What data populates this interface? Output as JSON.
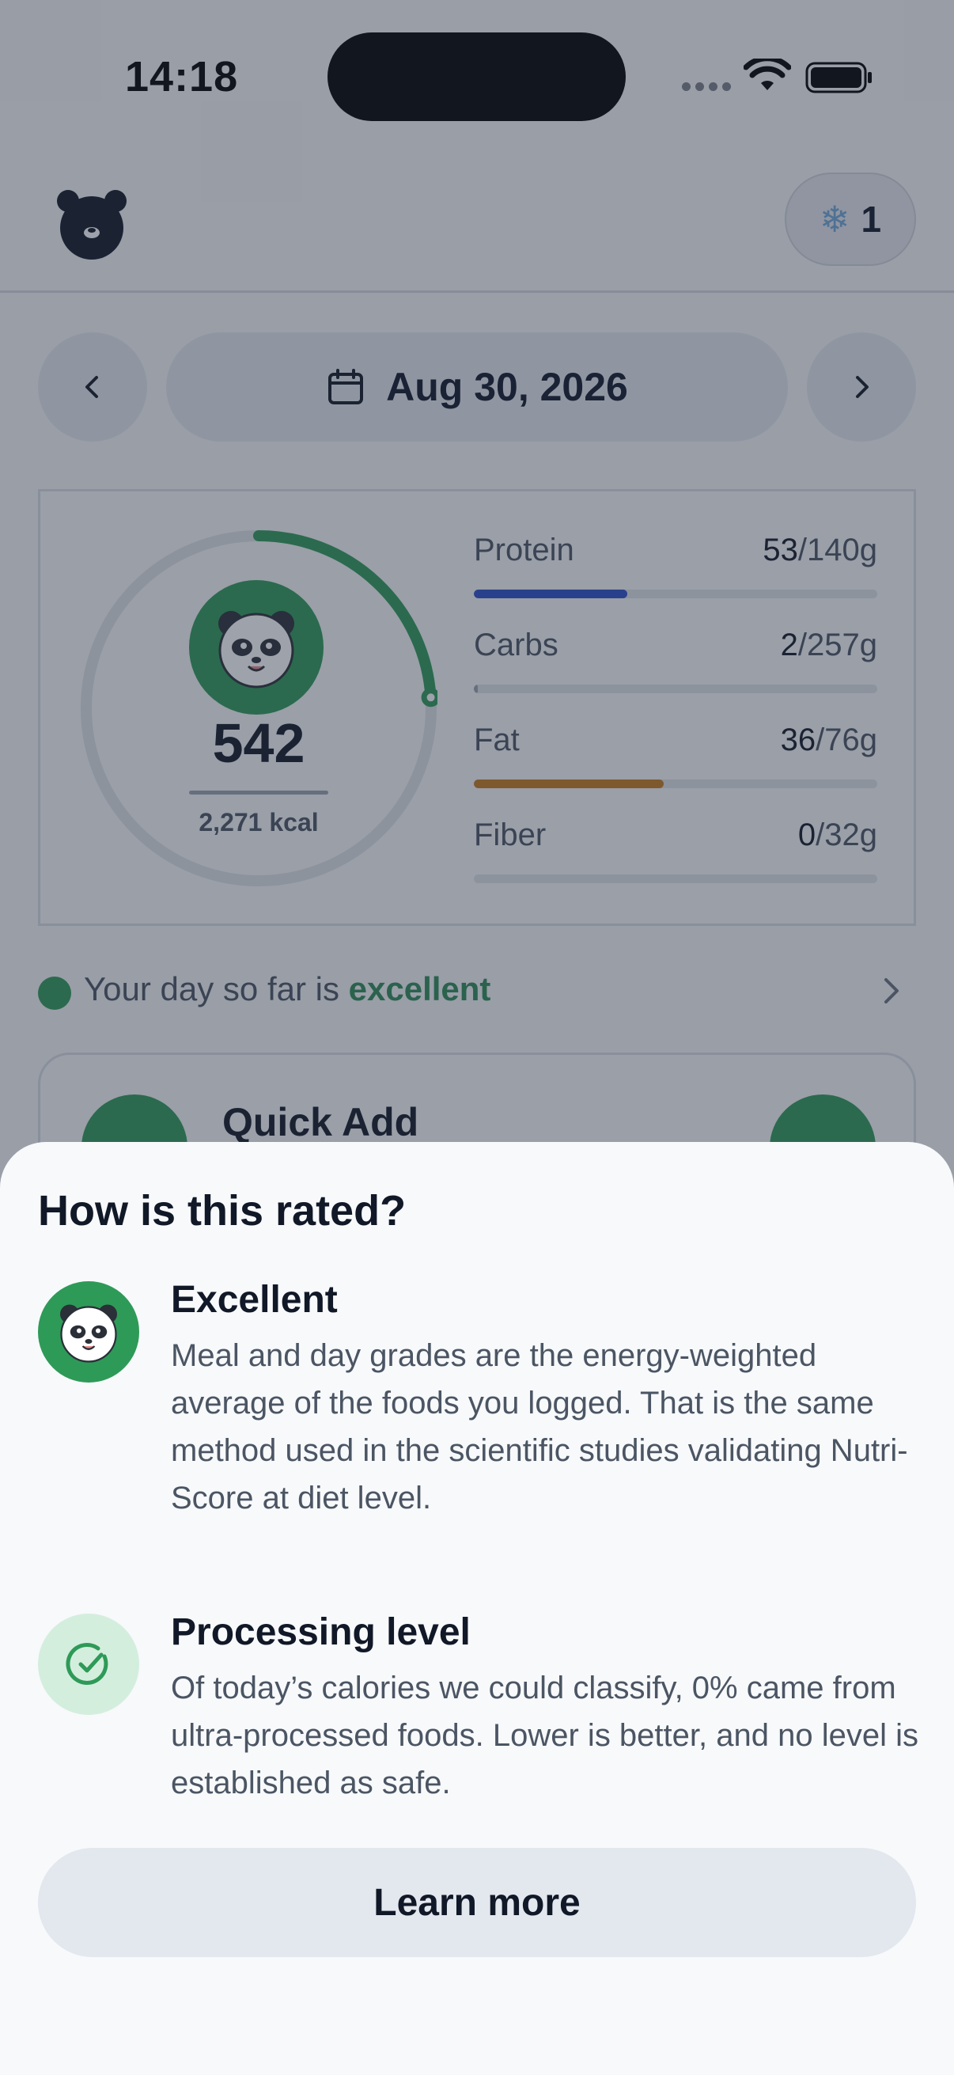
{
  "status_bar": {
    "time": "14:18"
  },
  "header": {
    "streak_icon": "snowflake-icon",
    "streak_count": "1"
  },
  "date_nav": {
    "date_label": "Aug 30, 2026"
  },
  "summary": {
    "calories_value": "542",
    "calories_goal": "2,271 kcal",
    "calories_progress": 0.24,
    "macros": [
      {
        "label": "Protein",
        "value": "53",
        "goal": "/140g",
        "progress": 0.38,
        "color": "#2b4fc8"
      },
      {
        "label": "Carbs",
        "value": "2",
        "goal": "/257g",
        "progress": 0.01,
        "color": "#9aa3af"
      },
      {
        "label": "Fat",
        "value": "36",
        "goal": "/76g",
        "progress": 0.47,
        "color": "#c57a1e"
      },
      {
        "label": "Fiber",
        "value": "0",
        "goal": "/32g",
        "progress": 0.0,
        "color": "#9aa3af"
      }
    ]
  },
  "day_rating": {
    "prefix": "Your day so far is ",
    "grade": "excellent"
  },
  "quick_add": {
    "title": "Quick Add"
  },
  "sheet": {
    "title": "How is this rated?",
    "items": [
      {
        "title": "Excellent",
        "body": "Meal and day grades are the energy-weighted average of the foods you logged. That is the same method used in the scientific studies validating Nutri-Score at diet level."
      },
      {
        "title": "Processing level",
        "body": "Of today’s calories we could classify, 0% came from ultra-processed foods. Lower is better, and no level is established as safe."
      }
    ],
    "button_label": "Learn more"
  },
  "colors": {
    "accent_green": "#2e9a58",
    "protein": "#2b4fc8",
    "fat": "#c57a1e"
  }
}
